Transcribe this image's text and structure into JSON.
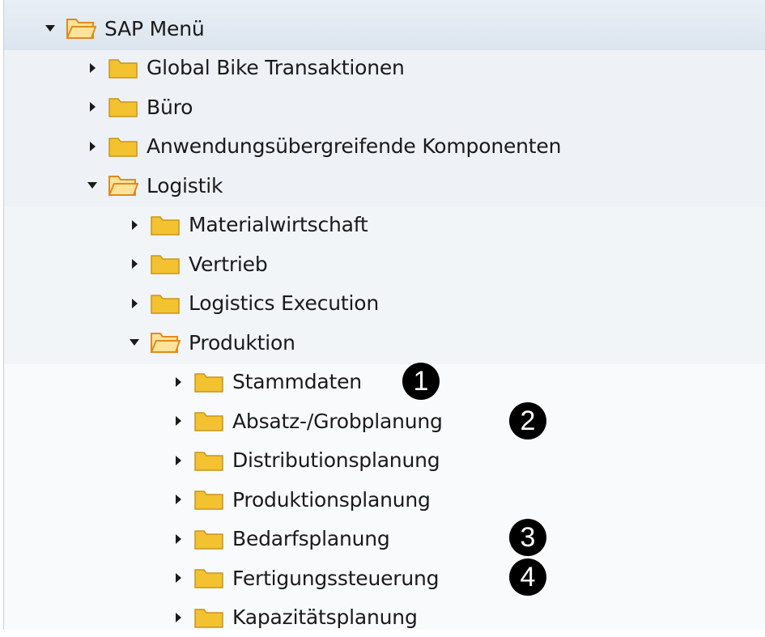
{
  "tree": {
    "nodes": [
      {
        "label": "SAP Menü",
        "level": 0,
        "expanded": true
      },
      {
        "label": "Global Bike Transaktionen",
        "level": 1,
        "expanded": false
      },
      {
        "label": "Büro",
        "level": 1,
        "expanded": false
      },
      {
        "label": "Anwendungsübergreifende Komponenten",
        "level": 1,
        "expanded": false
      },
      {
        "label": "Logistik",
        "level": 1,
        "expanded": true
      },
      {
        "label": "Materialwirtschaft",
        "level": 2,
        "expanded": false
      },
      {
        "label": "Vertrieb",
        "level": 2,
        "expanded": false
      },
      {
        "label": "Logistics Execution",
        "level": 2,
        "expanded": false
      },
      {
        "label": "Produktion",
        "level": 2,
        "expanded": true
      },
      {
        "label": "Stammdaten",
        "level": 3,
        "expanded": false
      },
      {
        "label": "Absatz-/Grobplanung",
        "level": 3,
        "expanded": false
      },
      {
        "label": "Distributionsplanung",
        "level": 3,
        "expanded": false
      },
      {
        "label": "Produktionsplanung",
        "level": 3,
        "expanded": false
      },
      {
        "label": "Bedarfsplanung",
        "level": 3,
        "expanded": false
      },
      {
        "label": "Fertigungssteuerung",
        "level": 3,
        "expanded": false
      },
      {
        "label": "Kapazitätsplanung",
        "level": 3,
        "expanded": false
      }
    ]
  },
  "badges": [
    "1",
    "2",
    "3",
    "4"
  ],
  "colors": {
    "folder_fill": "#f2c230",
    "folder_stroke": "#c9951a",
    "open_folder_fill": "#ffe39a",
    "open_folder_stroke": "#e08a1e",
    "badge_bg": "#000000",
    "badge_text": "#ffffff"
  },
  "icons": {
    "expanded": "caret-down-icon",
    "collapsed": "caret-right-icon",
    "open_folder": "open-folder-icon",
    "closed_folder": "folder-icon"
  }
}
